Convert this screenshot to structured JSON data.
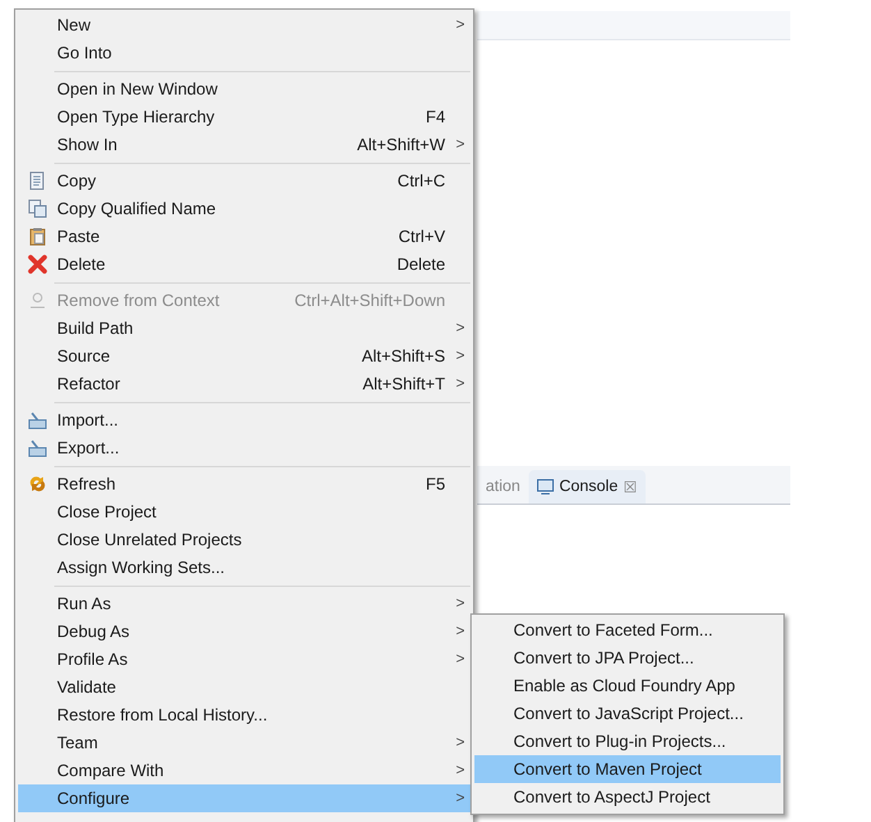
{
  "background": {
    "tabs": [
      {
        "label": "ation",
        "selected": false
      },
      {
        "label": "Console",
        "selected": true,
        "close": "☒"
      }
    ]
  },
  "menu": {
    "items": [
      {
        "kind": "item",
        "label": "New",
        "arrow": ">",
        "selected": false
      },
      {
        "kind": "item",
        "label": "Go Into",
        "selected": false
      },
      {
        "kind": "separator"
      },
      {
        "kind": "item",
        "label": "Open in New Window",
        "selected": false
      },
      {
        "kind": "item",
        "label": "Open Type Hierarchy",
        "shortcut": "F4",
        "selected": false
      },
      {
        "kind": "item",
        "label": "Show In",
        "shortcut": "Alt+Shift+W",
        "arrow": ">",
        "selected": false
      },
      {
        "kind": "separator"
      },
      {
        "kind": "item",
        "label": "Copy",
        "shortcut": "Ctrl+C",
        "selected": false
      },
      {
        "kind": "item",
        "label": "Copy Qualified Name",
        "selected": false
      },
      {
        "kind": "item",
        "label": "Paste",
        "shortcut": "Ctrl+V",
        "selected": false
      },
      {
        "kind": "item",
        "label": "Delete",
        "shortcut": "Delete",
        "selected": false
      },
      {
        "kind": "separator"
      },
      {
        "kind": "item",
        "label": "Remove from Context",
        "shortcut": "Ctrl+Alt+Shift+Down",
        "disabled": true,
        "selected": false
      },
      {
        "kind": "item",
        "label": "Build Path",
        "arrow": ">",
        "selected": false
      },
      {
        "kind": "item",
        "label": "Source",
        "shortcut": "Alt+Shift+S",
        "arrow": ">",
        "selected": false
      },
      {
        "kind": "item",
        "label": "Refactor",
        "shortcut": "Alt+Shift+T",
        "arrow": ">",
        "selected": false
      },
      {
        "kind": "separator"
      },
      {
        "kind": "item",
        "label": "Import...",
        "selected": false
      },
      {
        "kind": "item",
        "label": "Export...",
        "selected": false
      },
      {
        "kind": "separator"
      },
      {
        "kind": "item",
        "label": "Refresh",
        "shortcut": "F5",
        "selected": false
      },
      {
        "kind": "item",
        "label": "Close Project",
        "selected": false
      },
      {
        "kind": "item",
        "label": "Close Unrelated Projects",
        "selected": false
      },
      {
        "kind": "item",
        "label": "Assign Working Sets...",
        "selected": false
      },
      {
        "kind": "separator"
      },
      {
        "kind": "item",
        "label": "Run As",
        "arrow": ">",
        "selected": false
      },
      {
        "kind": "item",
        "label": "Debug As",
        "arrow": ">",
        "selected": false
      },
      {
        "kind": "item",
        "label": "Profile As",
        "arrow": ">",
        "selected": false
      },
      {
        "kind": "item",
        "label": "Validate",
        "selected": false
      },
      {
        "kind": "item",
        "label": "Restore from Local History...",
        "selected": false
      },
      {
        "kind": "item",
        "label": "Team",
        "arrow": ">",
        "selected": false
      },
      {
        "kind": "item",
        "label": "Compare With",
        "arrow": ">",
        "selected": false
      },
      {
        "kind": "item",
        "label": "Configure",
        "arrow": ">",
        "selected": true
      }
    ]
  },
  "submenu": {
    "items": [
      {
        "kind": "item",
        "label": "Convert to Faceted Form...",
        "selected": false
      },
      {
        "kind": "item",
        "label": "Convert to JPA Project...",
        "selected": false
      },
      {
        "kind": "item",
        "label": "Enable as Cloud Foundry App",
        "selected": false
      },
      {
        "kind": "item",
        "label": "Convert to JavaScript Project...",
        "selected": false
      },
      {
        "kind": "item",
        "label": "Convert to Plug-in Projects...",
        "selected": false
      },
      {
        "kind": "item",
        "label": "Convert to Maven Project",
        "selected": true
      },
      {
        "kind": "item",
        "label": "Convert to AspectJ Project",
        "selected": false
      }
    ]
  }
}
